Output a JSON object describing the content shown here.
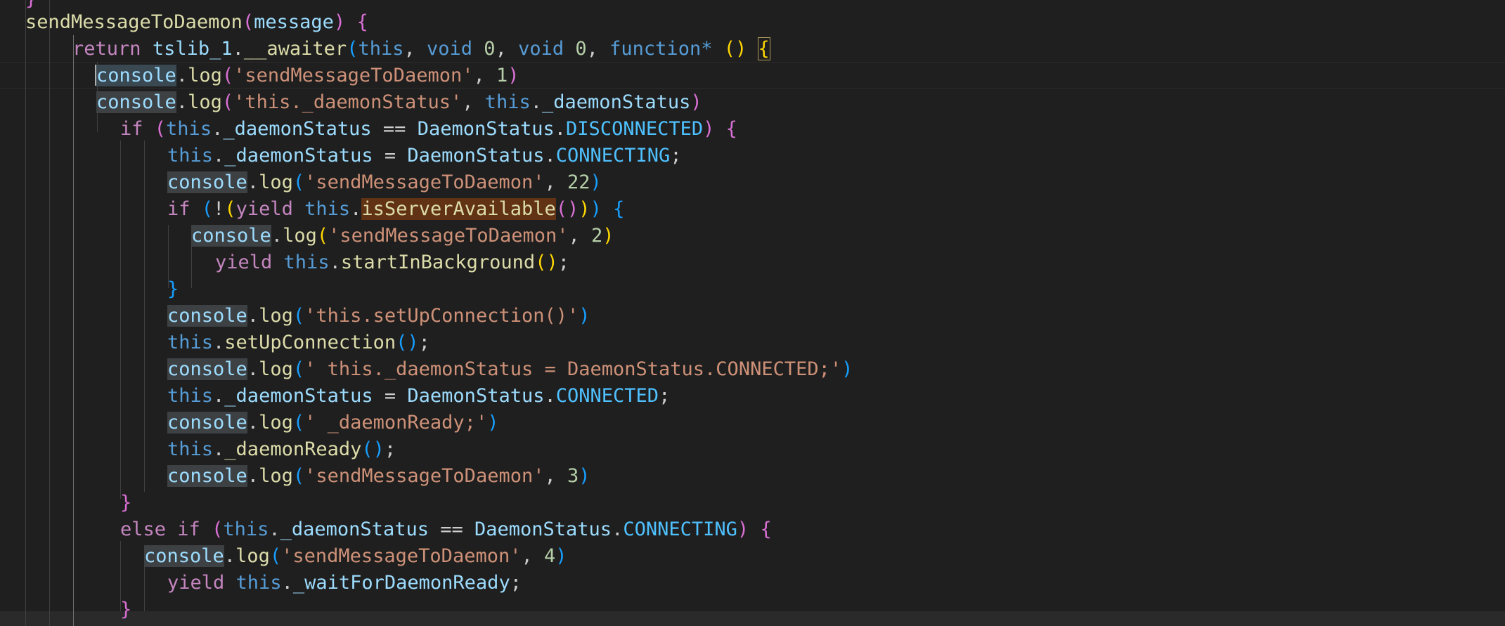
{
  "editor": {
    "lines": {
      "l0": {
        "t1": "}"
      },
      "l1": {
        "t1": "sendMessageToDaemon",
        "t2": "(",
        "t3": "message",
        "t4": ")",
        "t5": " ",
        "t6": "{"
      },
      "l2": {
        "t1": "return",
        "t2": " ",
        "t3": "tslib_1",
        "t4": ".",
        "t5": "__awaiter",
        "t6": "(",
        "t7": "this",
        "t8": ", ",
        "t9": "void",
        "t10": " ",
        "t11": "0",
        "t12": ", ",
        "t13": "void",
        "t14": " ",
        "t15": "0",
        "t16": ", ",
        "t17": "function*",
        "t18": " ",
        "t19": "(",
        "t20": ")",
        "t21": " ",
        "t22": "{"
      },
      "l3": {
        "t1": "console",
        "t2": ".",
        "t3": "log",
        "t4": "(",
        "t5": "'sendMessageToDaemon'",
        "t6": ", ",
        "t7": "1",
        "t8": ")"
      },
      "l4": {
        "t1": "console",
        "t2": ".",
        "t3": "log",
        "t4": "(",
        "t5": "'this._daemonStatus'",
        "t6": ", ",
        "t7": "this",
        "t8": ".",
        "t9": "_daemonStatus",
        "t10": ")"
      },
      "l5": {
        "t1": "if",
        "t2": " ",
        "t3": "(",
        "t4": "this",
        "t5": ".",
        "t6": "_daemonStatus",
        "t7": " == ",
        "t8": "DaemonStatus",
        "t9": ".",
        "t10": "DISCONNECTED",
        "t11": ")",
        "t12": " ",
        "t13": "{"
      },
      "l6": {
        "t1": "this",
        "t2": ".",
        "t3": "_daemonStatus",
        "t4": " = ",
        "t5": "DaemonStatus",
        "t6": ".",
        "t7": "CONNECTING",
        "t8": ";"
      },
      "l7": {
        "t1": "console",
        "t2": ".",
        "t3": "log",
        "t4": "(",
        "t5": "'sendMessageToDaemon'",
        "t6": ", ",
        "t7": "22",
        "t8": ")"
      },
      "l8": {
        "t1": "if",
        "t2": " ",
        "t3": "(",
        "t4": "!",
        "t5": "(",
        "t6": "yield",
        "t7": " ",
        "t8": "this",
        "t9": ".",
        "t10": "isServerAvailable",
        "t11": "(",
        "t12": ")",
        "t13": ")",
        "t14": ")",
        "t15": " ",
        "t16": "{"
      },
      "l9": {
        "t1": "console",
        "t2": ".",
        "t3": "log",
        "t4": "(",
        "t5": "'sendMessageToDaemon'",
        "t6": ", ",
        "t7": "2",
        "t8": ")"
      },
      "l10": {
        "t1": "yield",
        "t2": " ",
        "t3": "this",
        "t4": ".",
        "t5": "startInBackground",
        "t6": "(",
        "t7": ")",
        "t8": ";"
      },
      "l11": {
        "t1": "}"
      },
      "l12": {
        "t1": "console",
        "t2": ".",
        "t3": "log",
        "t4": "(",
        "t5": "'this.setUpConnection()'",
        "t6": ")"
      },
      "l13": {
        "t1": "this",
        "t2": ".",
        "t3": "setUpConnection",
        "t4": "(",
        "t5": ")",
        "t6": ";"
      },
      "l14": {
        "t1": "console",
        "t2": ".",
        "t3": "log",
        "t4": "(",
        "t5": "' this._daemonStatus = DaemonStatus.CONNECTED;'",
        "t6": ")"
      },
      "l15": {
        "t1": "this",
        "t2": ".",
        "t3": "_daemonStatus",
        "t4": " = ",
        "t5": "DaemonStatus",
        "t6": ".",
        "t7": "CONNECTED",
        "t8": ";"
      },
      "l16": {
        "t1": "console",
        "t2": ".",
        "t3": "log",
        "t4": "(",
        "t5": "' _daemonReady;'",
        "t6": ")"
      },
      "l17": {
        "t1": "this",
        "t2": ".",
        "t3": "_daemonReady",
        "t4": "(",
        "t5": ")",
        "t6": ";"
      },
      "l18": {
        "t1": "console",
        "t2": ".",
        "t3": "log",
        "t4": "(",
        "t5": "'sendMessageToDaemon'",
        "t6": ", ",
        "t7": "3",
        "t8": ")"
      },
      "l19": {
        "t1": "}"
      },
      "l20": {
        "t1": "else",
        "t2": " ",
        "t3": "if",
        "t4": " ",
        "t5": "(",
        "t6": "this",
        "t7": ".",
        "t8": "_daemonStatus",
        "t9": " == ",
        "t10": "DaemonStatus",
        "t11": ".",
        "t12": "CONNECTING",
        "t13": ")",
        "t14": " ",
        "t15": "{"
      },
      "l21": {
        "t1": "console",
        "t2": ".",
        "t3": "log",
        "t4": "(",
        "t5": "'sendMessageToDaemon'",
        "t6": ", ",
        "t7": "4",
        "t8": ")"
      },
      "l22": {
        "t1": "yield",
        "t2": " ",
        "t3": "this",
        "t4": ".",
        "t5": "_waitForDaemonReady",
        "t6": ";"
      },
      "l23": {
        "t1": "}"
      }
    }
  },
  "theme": {
    "background": "#1f1f1f",
    "keyword": "#c586c0",
    "storage": "#569cd6",
    "function": "#dcdcaa",
    "variable": "#9cdcfe",
    "class": "#4ec9b0",
    "enum_member": "#4fc1ff",
    "string": "#ce9178",
    "number": "#b5cea8",
    "bracket_level_1": "#ffd700",
    "bracket_level_2": "#da70d6",
    "bracket_level_3": "#179fff",
    "find_match": "#613214",
    "word_highlight": "#3e4143"
  }
}
